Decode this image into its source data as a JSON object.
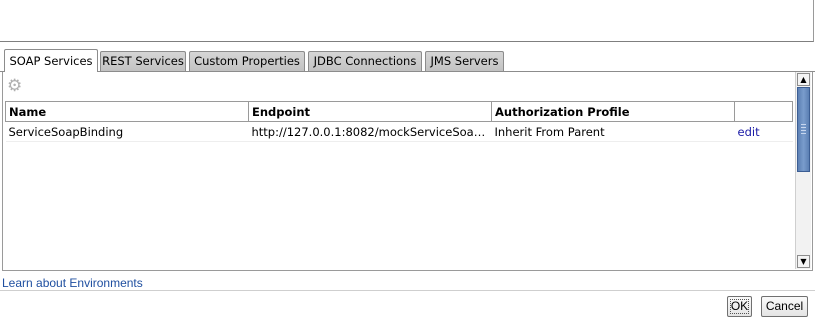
{
  "tabs": [
    {
      "label": "SOAP Services",
      "active": true
    },
    {
      "label": "REST Services",
      "active": false
    },
    {
      "label": "Custom Properties",
      "active": false
    },
    {
      "label": "JDBC Connections",
      "active": false
    },
    {
      "label": "JMS Servers",
      "active": false
    }
  ],
  "toolbar": {
    "settings_icon": "gear-icon"
  },
  "table": {
    "columns": [
      "Name",
      "Endpoint",
      "Authorization Profile",
      ""
    ],
    "rows": [
      {
        "name": "ServiceSoapBinding",
        "endpoint": "http://127.0.0.1:8082/mockServiceSoapBind...",
        "auth": "Inherit From Parent",
        "action": "edit"
      }
    ]
  },
  "footer": {
    "learn_link": "Learn about Environments",
    "ok_label": "OK",
    "cancel_label": "Cancel"
  },
  "colors": {
    "link": "#1a1aa6",
    "scroll_thumb": "#5b7fb3"
  }
}
